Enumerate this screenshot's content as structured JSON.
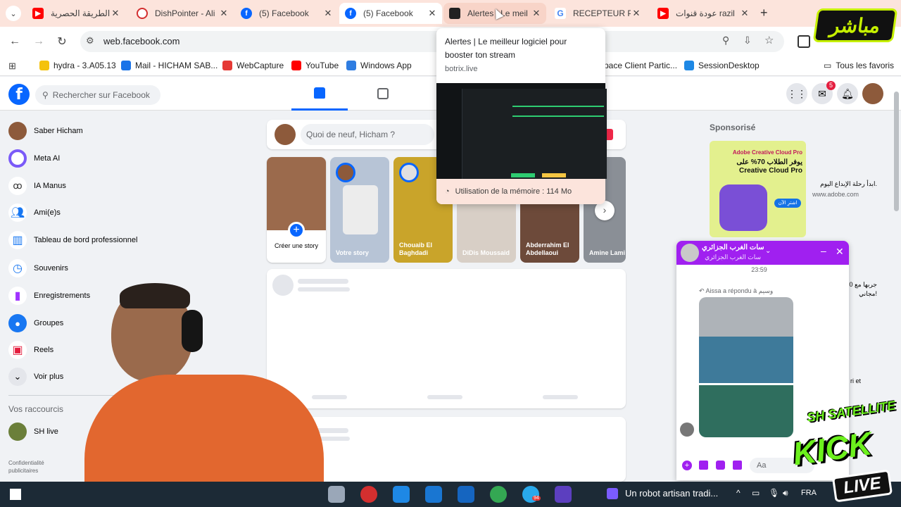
{
  "tabs": [
    {
      "title": "الطريقة الحصرية",
      "icon": "youtube-icon",
      "color": "#ff0000"
    },
    {
      "title": "DishPointer - Ali",
      "icon": "dishpointer-icon",
      "color": "#d32f2f"
    },
    {
      "title": "(5) Facebook",
      "icon": "facebook-icon",
      "color": "#0866ff"
    },
    {
      "title": "(5) Facebook",
      "icon": "facebook-icon",
      "color": "#0866ff"
    },
    {
      "title": "Alertes | Le meil",
      "icon": "botrix-icon",
      "color": "#222222"
    },
    {
      "title": "RECEPTEUR PRO",
      "icon": "google-icon",
      "color": "#4285f4"
    },
    {
      "title": "عودة قنوات razil",
      "icon": "youtube-icon",
      "color": "#ff0000"
    }
  ],
  "new_tab": "+",
  "toolbar": {
    "url": "web.facebook.com"
  },
  "bookmarks": [
    {
      "label": "hydra - 3.A05.13",
      "color": "#f4c20d"
    },
    {
      "label": "Mail - HICHAM SAB...",
      "color": "#1a73e8"
    },
    {
      "label": "WebCapture",
      "color": "#e53935"
    },
    {
      "label": "YouTube",
      "color": "#ff0000"
    },
    {
      "label": "Windows App",
      "color": "#2f7de1"
    },
    {
      "label": "pace Client Partic...",
      "color": "#ffffff"
    },
    {
      "label": "SessionDesktop",
      "color": "#1e88e5"
    }
  ],
  "all_bookmarks": "Tous les favoris",
  "facebook": {
    "logo": "f",
    "search_placeholder": "Rechercher sur Facebook",
    "notification_count": "5"
  },
  "sidebar": [
    {
      "label": "Saber Hicham",
      "icon": "avatar"
    },
    {
      "label": "Meta AI",
      "icon": "meta-ai-icon"
    },
    {
      "label": "IA Manus",
      "icon": "manus-icon"
    },
    {
      "label": "Ami(e)s",
      "icon": "friends-icon"
    },
    {
      "label": "Tableau de bord professionnel",
      "icon": "dashboard-icon"
    },
    {
      "label": "Souvenirs",
      "icon": "memories-icon"
    },
    {
      "label": "Enregistrements",
      "icon": "bookmark-icon"
    },
    {
      "label": "Groupes",
      "icon": "groups-icon"
    },
    {
      "label": "Reels",
      "icon": "reels-icon"
    },
    {
      "label": "Voir plus",
      "icon": "chevron-down-icon"
    }
  ],
  "shortcuts_title": "Vos raccourcis",
  "shortcuts": [
    {
      "label": "SH live"
    }
  ],
  "footer_text": "Confidentialité\npublicitaires",
  "composer": {
    "placeholder": "Quoi de neuf, Hicham ?"
  },
  "stories": [
    {
      "name": "Créer une story"
    },
    {
      "name": "Votre story"
    },
    {
      "name": "Chouaib El Baghdadi"
    },
    {
      "name": "DiDis Moussaid"
    },
    {
      "name": "Abderrahim El Abdellaoui"
    },
    {
      "name": "Amine Lami"
    }
  ],
  "tooltip": {
    "title": "Alertes | Le meilleur logiciel pour booster ton stream",
    "domain": "botrix.live",
    "memory": "Utilisation de la mémoire : 114 Mo"
  },
  "sponsored": {
    "label": "Sponsorisé",
    "ad_brand": "Adobe Creative Cloud Pro",
    "ad_headline": "يوفر الطلاب 70% على Creative Cloud Pro",
    "ad_button": "اشترِ الآن",
    "ad_text": "ابدأ رحلة الإبداع اليوم.",
    "ad_domain": "www.adobe.com",
    "side_snippet": "جربها مع 0\nمجاني!",
    "side_snippet2": "ri et"
  },
  "chat": {
    "name": "سات الغرب الجزائري",
    "subtitle": "سات الغرب الجزائري",
    "time": "23:59",
    "reply_note": "Aissa a répondu à وسيم",
    "input_placeholder": "Aa"
  },
  "taskbar": {
    "now_playing": "Un robot artisan tradi...",
    "lang": "FRA",
    "telegram_badge": "94"
  },
  "overlays": {
    "mubashir": "مباشر",
    "sh_satellite": "SH SATELLITE",
    "kick": "KICK",
    "live": "LIVE"
  }
}
